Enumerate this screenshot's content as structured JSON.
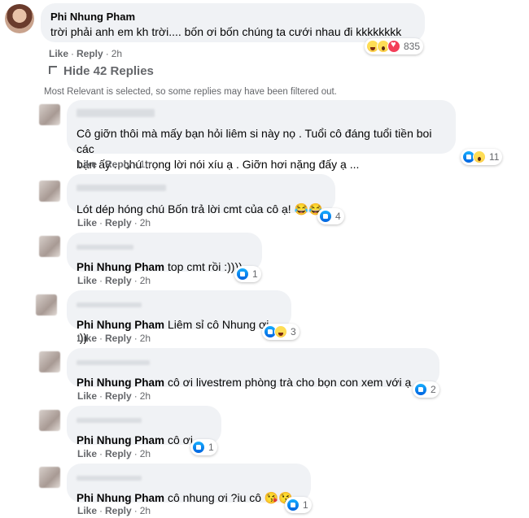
{
  "top_comment": {
    "author": "Phi Nhung Pham",
    "text": "trời phải anh em kh trời.... bốn ơi bốn chúng ta cưới nhau đi kkkkkkkk",
    "like": "Like",
    "reply": "Reply",
    "time": "2h",
    "reaction_count": "835",
    "reactions": [
      "haha",
      "wow",
      "love"
    ]
  },
  "hide_replies_label": "Hide 42 Replies",
  "filter_notice": "Most Relevant is selected, so some replies may have been filtered out.",
  "replies": [
    {
      "author": "",
      "text_lines": [
        "Cô giỡn thôi mà mấy bạn hỏi liêm si này nọ . Tuổi cô đáng tuổi tiền boi các",
        "bạn ấy .. chú trọng lời nói xíu ạ . Giỡn hơi nặng đấy ạ ..."
      ],
      "like": "Like",
      "reply": "Reply",
      "time": "1h",
      "reaction_count": "11",
      "reactions": [
        "like",
        "wow"
      ]
    },
    {
      "author": "",
      "text": "Lót dép hóng chú Bốn trả lời cmt của cô ạ! 😂😂",
      "like": "Like",
      "reply": "Reply",
      "time": "2h",
      "reaction_count": "4",
      "reactions": [
        "like"
      ]
    },
    {
      "author": "Phi Nhung Pham",
      "text": "top cmt rồi :))))",
      "like": "Like",
      "reply": "Reply",
      "time": "2h",
      "reaction_count": "1",
      "reactions": [
        "like"
      ]
    },
    {
      "author": "Phi Nhung Pham",
      "text": "Liêm sỉ cô Nhung ơi :))",
      "like": "Like",
      "reply": "Reply",
      "time": "2h",
      "reaction_count": "3",
      "reactions": [
        "like",
        "haha"
      ]
    },
    {
      "author": "Phi Nhung Pham",
      "text": "cô ơi livestrem phòng trà cho bọn con xem với ạ",
      "like": "Like",
      "reply": "Reply",
      "time": "2h",
      "reaction_count": "2",
      "reactions": [
        "like"
      ]
    },
    {
      "author": "Phi Nhung Pham",
      "text": "cô ơi..",
      "like": "Like",
      "reply": "Reply",
      "time": "2h",
      "reaction_count": "1",
      "reactions": [
        "like"
      ]
    },
    {
      "author": "Phi Nhung Pham",
      "text": "cô nhung ơi ?iu cô 😘😘",
      "like": "Like",
      "reply": "Reply",
      "time": "2h",
      "reaction_count": "1",
      "reactions": [
        "like"
      ]
    }
  ]
}
